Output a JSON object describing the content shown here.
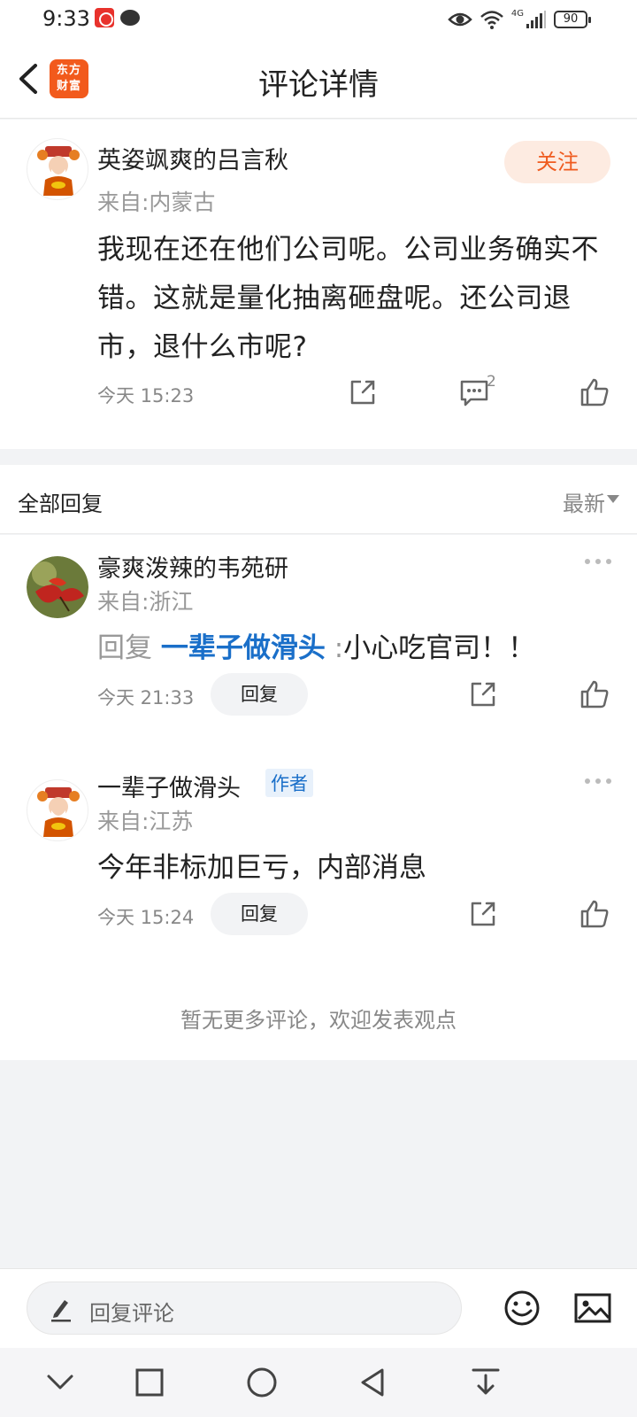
{
  "status_bar": {
    "time": "9:33",
    "battery": "90",
    "network": "4G"
  },
  "header": {
    "title": "评论详情",
    "logo_line1": "东方",
    "logo_line2": "财富"
  },
  "post": {
    "username": "英姿飒爽的吕言秋",
    "location": "来自:内蒙古",
    "follow_label": "关注",
    "text": "我现在还在他们公司呢。公司业务确实不错。这就是量化抽离砸盘呢。还公司退市，退什么市呢?",
    "timestamp": "今天 15:23",
    "comment_count": "2"
  },
  "replies_section": {
    "title": "全部回复",
    "sort_label": "最新"
  },
  "replies": [
    {
      "username": "豪爽泼辣的韦苑研",
      "location": "来自:浙江",
      "prefix": "回复",
      "target": "一辈子做滑头",
      "separator": ":",
      "text": "小心吃官司！！",
      "timestamp": "今天 21:33",
      "reply_label": "回复"
    },
    {
      "username": "一辈子做滑头",
      "author_tag": "作者",
      "location": "来自:江苏",
      "text": "今年非标加巨亏，内部消息",
      "timestamp": "今天 15:24",
      "reply_label": "回复"
    }
  ],
  "no_more": "暂无更多评论，欢迎发表观点",
  "input_bar": {
    "placeholder": "回复评论"
  },
  "colors": {
    "accent_orange": "#ef5b1f",
    "link_blue": "#1a6fc9",
    "background": "#f2f3f5"
  }
}
